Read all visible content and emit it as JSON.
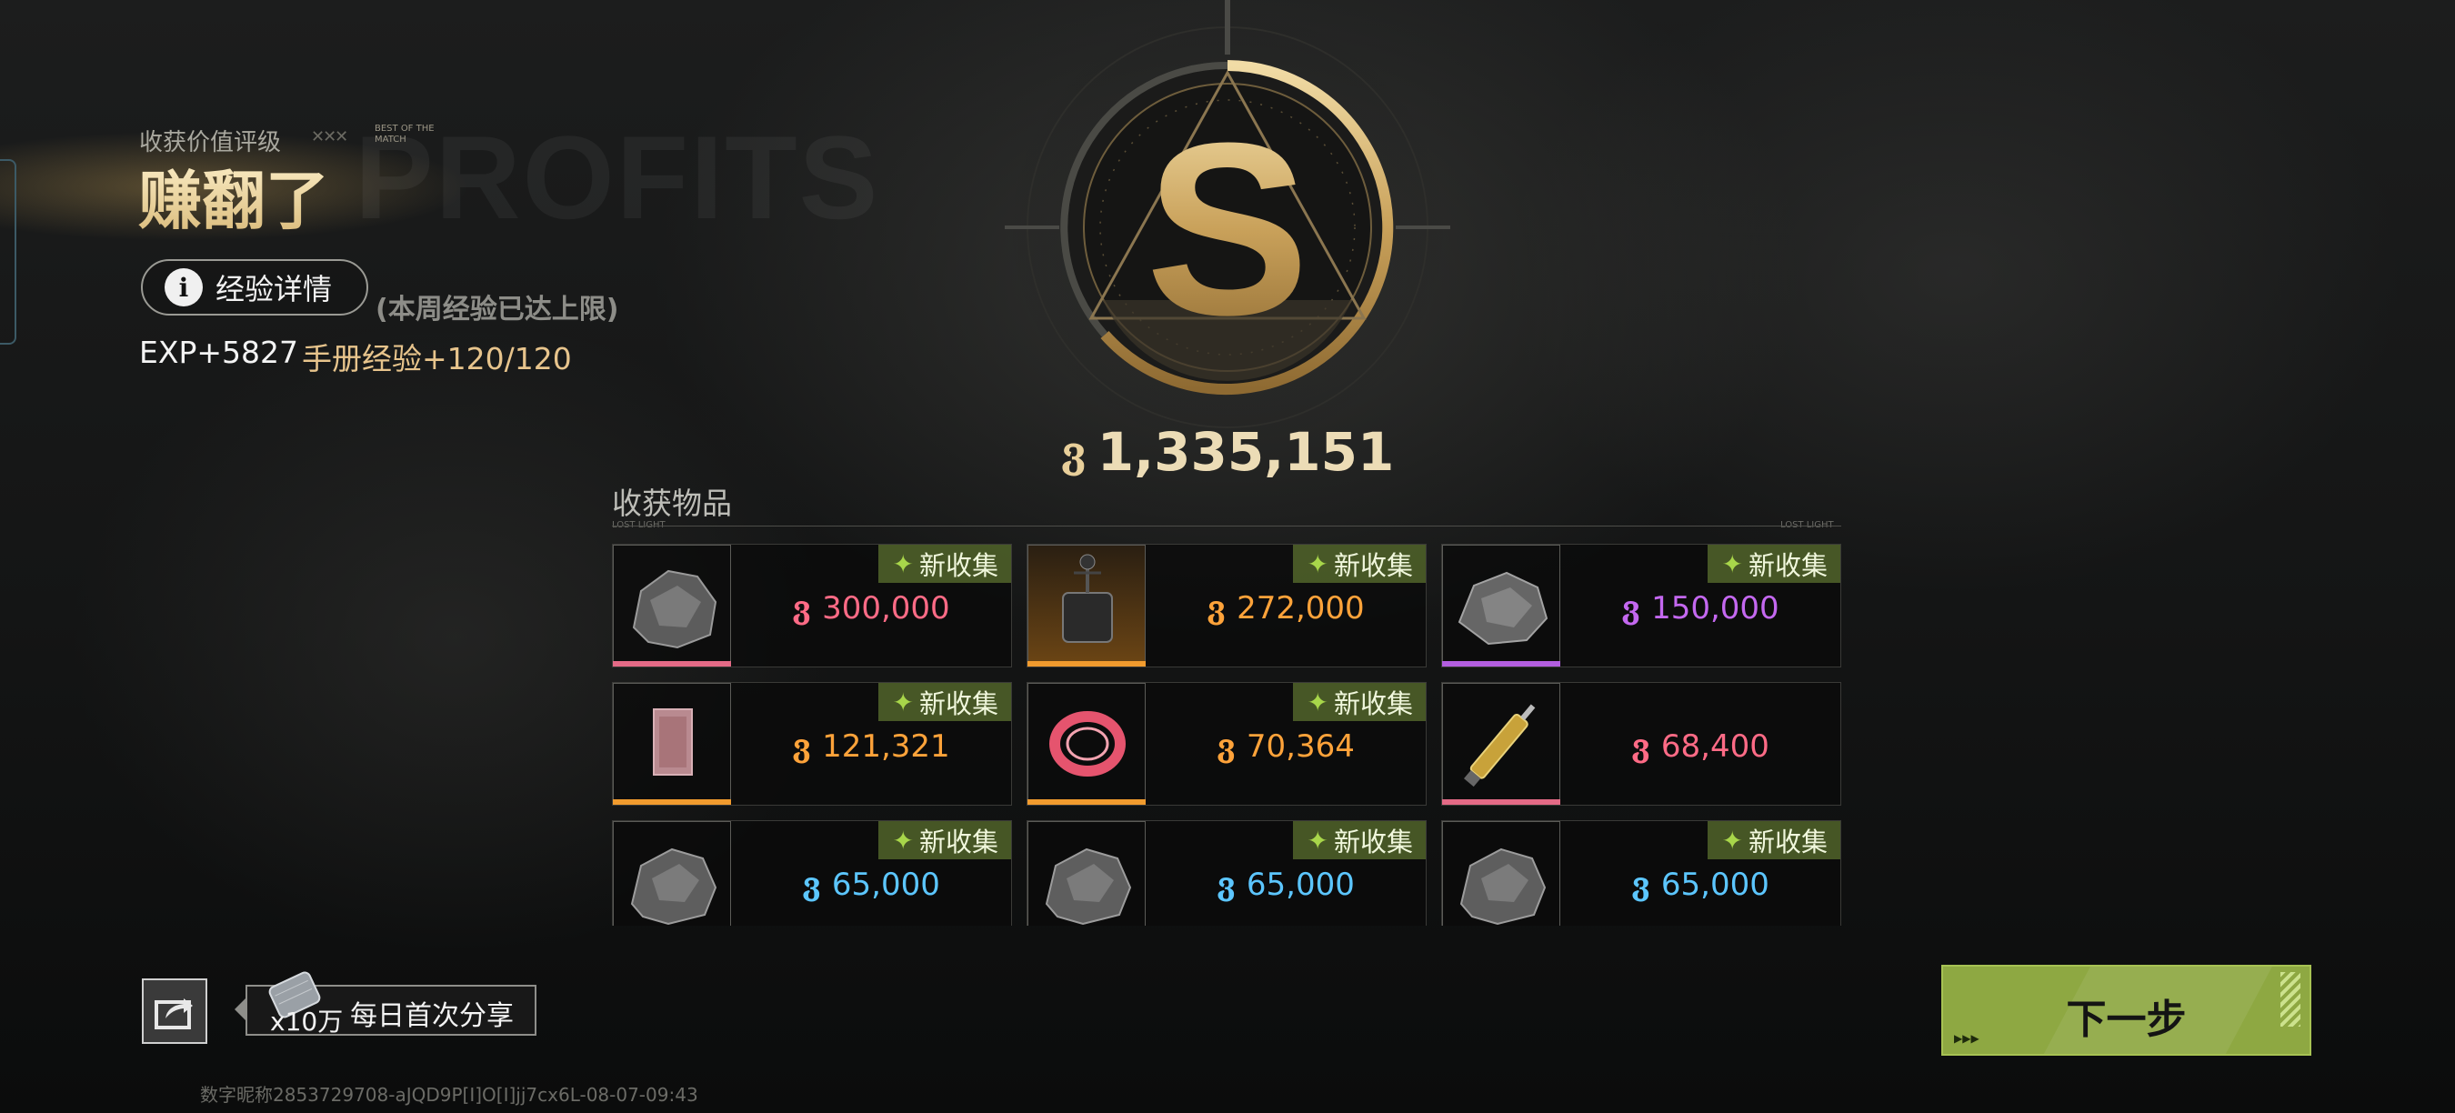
{
  "rating": {
    "label": "收获价值评级",
    "badge_text": "BEST OF THE MATCH",
    "watermark": "PROFITS",
    "value": "赚翻了",
    "grade": "S"
  },
  "experience": {
    "details_button": "经验详情",
    "weekly_note": "(本周经验已达上限)",
    "exp": "EXP+5827",
    "manual_exp": "手册经验+120/120"
  },
  "total": {
    "currency_symbol": "ვ",
    "value": "1,335,151"
  },
  "items_section": {
    "title": "收获物品",
    "left_caption": "LOST LIGHT",
    "right_caption": "LOST LIGHT",
    "items": [
      {
        "new_label": "新收集",
        "price": "300,000",
        "color": "#ff6b86",
        "rarity": "#e46a86",
        "icon": "ore-rock-icon"
      },
      {
        "new_label": "新收集",
        "price": "272,000",
        "color": "#ffa33a",
        "rarity": "#f19b2e",
        "icon": "device-icon"
      },
      {
        "new_label": "新收集",
        "price": "150,000",
        "color": "#c468f0",
        "rarity": "#b35ee0",
        "icon": "ore-rock-icon"
      },
      {
        "new_label": "新收集",
        "price": "121,321",
        "color": "#ffa33a",
        "rarity": "#f19b2e",
        "icon": "card-icon"
      },
      {
        "new_label": "新收集",
        "price": "70,364",
        "color": "#ffa33a",
        "rarity": "#f19b2e",
        "icon": "ring-icon"
      },
      {
        "new_label": "",
        "price": "68,400",
        "color": "#ff6b86",
        "rarity": "#e46a86",
        "icon": "syringe-icon"
      },
      {
        "new_label": "新收集",
        "price": "65,000",
        "color": "#5cc6ff",
        "rarity": "#5cc6ff",
        "icon": "ore-rock-icon"
      },
      {
        "new_label": "新收集",
        "price": "65,000",
        "color": "#5cc6ff",
        "rarity": "#5cc6ff",
        "icon": "ore-rock-icon"
      },
      {
        "new_label": "新收集",
        "price": "65,000",
        "color": "#5cc6ff",
        "rarity": "#5cc6ff",
        "icon": "ore-rock-icon"
      }
    ]
  },
  "share": {
    "multiplier": "x10万",
    "label": "每日首次分享"
  },
  "footer": {
    "player_id": "数字昵称2853729708-aJQD9P[I]O[I]jj7cx6L-08-07-09:43"
  },
  "next_button": {
    "label": "下一步"
  }
}
